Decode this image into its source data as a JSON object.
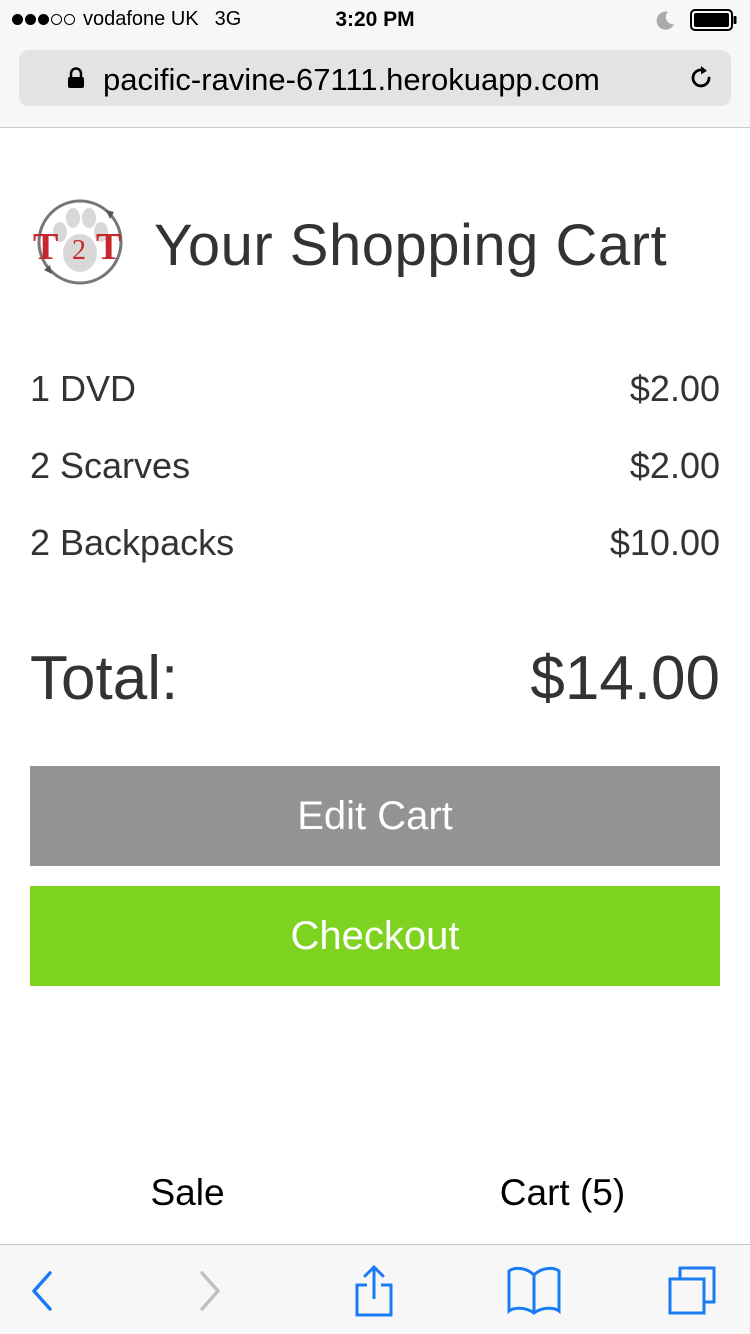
{
  "status_bar": {
    "carrier": "vodafone UK",
    "network": "3G",
    "time": "3:20 PM",
    "signal_bars_filled": 3,
    "signal_bars_total": 5
  },
  "browser": {
    "url": "pacific-ravine-67111.herokuapp.com"
  },
  "page": {
    "logo_text": "T2T",
    "title": "Your Shopping Cart"
  },
  "cart": {
    "items": [
      {
        "name": "1 DVD",
        "price": "$2.00"
      },
      {
        "name": "2 Scarves",
        "price": "$2.00"
      },
      {
        "name": "2 Backpacks",
        "price": "$10.00"
      }
    ],
    "total_label": "Total:",
    "total_value": "$14.00",
    "edit_label": "Edit Cart",
    "checkout_label": "Checkout"
  },
  "nav": {
    "sale_label": "Sale",
    "cart_label": "Cart (5)"
  },
  "colors": {
    "edit_button": "#939393",
    "checkout_button": "#7ed321",
    "ios_blue": "#1a7cf5"
  },
  "toolbar_icons": [
    "back-icon",
    "forward-icon",
    "share-icon",
    "bookmarks-icon",
    "tabs-icon"
  ]
}
